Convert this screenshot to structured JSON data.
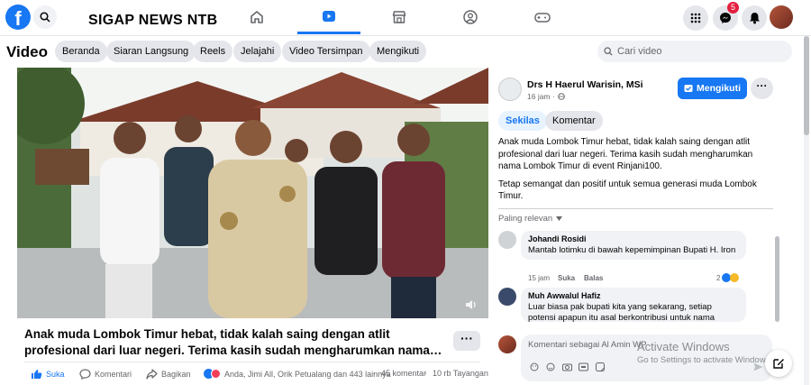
{
  "topbar": {
    "brand": "SIGAP NEWS NTB",
    "logo_letter": "f",
    "notification_count": "5",
    "nav_icons": [
      "home-icon",
      "video-icon",
      "marketplace-icon",
      "groups-icon",
      "gaming-icon"
    ],
    "active_nav": "video-icon",
    "accent": "#1877f2"
  },
  "subnav": {
    "title": "Video",
    "pills": [
      "Beranda",
      "Siaran Langsung",
      "Reels",
      "Jelajahi",
      "Video Tersimpan",
      "Mengikuti"
    ],
    "search_placeholder": "Cari video"
  },
  "post": {
    "title_line1": "Anak muda Lombok Timur hebat, tidak kalah saing dengan atlit",
    "title_line2": "profesional dari luar negeri. Terima kasih sudah mengharumkan nama…",
    "more_label": "···",
    "like_label": "Suka",
    "comment_label": "Komentari",
    "share_label": "Bagikan",
    "reactions_text": "Anda, Jimi All, Orik Petualang dan 443 lainnya",
    "comments_count": "45 komentar",
    "views_text": "10 rb Tayangan"
  },
  "author": {
    "name": "Drs H Haerul Warisin, MSi",
    "time": "16 jam ·",
    "follow_label": "Mengikuti",
    "more_label": "···"
  },
  "tabs": {
    "active": "Sekilas",
    "other": "Komentar"
  },
  "description": {
    "paragraph1": "Anak muda Lombok Timur hebat, tidak kalah saing dengan atlit profesional dari luar negeri. Terima kasih sudah mengharumkan nama Lombok Timur di event Rinjani100.",
    "paragraph2": "Tetap semangat dan positif untuk semua generasi muda Lombok Timur."
  },
  "sort_label": "Paling relevan",
  "comments": [
    {
      "name": "Johandi Rosidi",
      "text": "Mantab lotimku di bawah kepemimpinan Bupati H. Iron",
      "time": "15 jam",
      "like": "Suka",
      "reply": "Balas",
      "reactions": "2"
    },
    {
      "name": "Muh Awwalul Hafiz",
      "text": "Luar biasa pak bupati kita yang sekarang, setiap potensi apapun itu asal berkontribusi untuk nama"
    }
  ],
  "composer": {
    "placeholder": "Komentari sebagai Al Amin WP"
  },
  "watermark": {
    "line1": "Activate Windows",
    "line2": "Go to Settings to activate Windows."
  }
}
